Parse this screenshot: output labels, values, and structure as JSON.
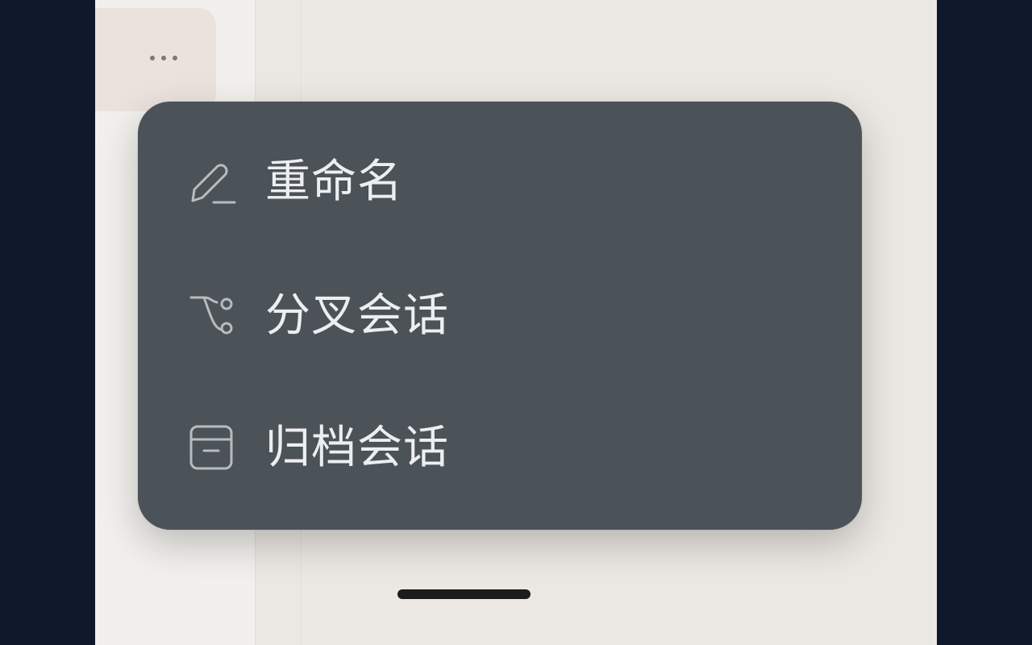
{
  "menu": {
    "items": [
      {
        "label": "重命名",
        "icon": "pencil-icon"
      },
      {
        "label": "分叉会话",
        "icon": "branch-icon"
      },
      {
        "label": "归档会话",
        "icon": "archive-icon"
      }
    ]
  },
  "colors": {
    "menu_background": "#4b5258",
    "menu_text": "#eceeef",
    "backdrop": "#0f172a"
  }
}
